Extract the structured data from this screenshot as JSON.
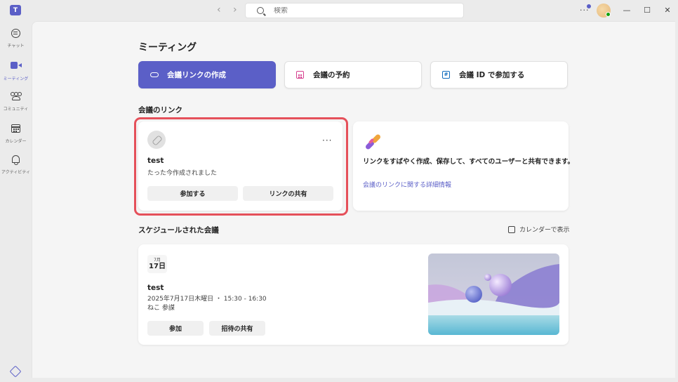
{
  "titlebar": {
    "search_placeholder": "検索",
    "more": "···",
    "window_controls": {
      "minimize": "—",
      "maximize": "☐",
      "close": "✕"
    }
  },
  "rail": {
    "items": [
      {
        "label": "チャット",
        "icon": "chat-icon"
      },
      {
        "label": "ミーティング",
        "icon": "meeting-icon",
        "active": true
      },
      {
        "label": "コミュニティ",
        "icon": "community-icon"
      },
      {
        "label": "カレンダー",
        "icon": "calendar-icon"
      },
      {
        "label": "アクティビティ",
        "icon": "bell-icon"
      }
    ]
  },
  "page": {
    "title": "ミーティング",
    "actions": {
      "create_link": "会議リンクの作成",
      "schedule": "会議の予約",
      "join_id": "会議 ID で参加する"
    }
  },
  "links_section": {
    "title": "会議のリンク",
    "card": {
      "name": "test",
      "status": "たった今作成されました",
      "join": "参加する",
      "share": "リンクの共有",
      "more": "···"
    },
    "promo": {
      "text": "リンクをすばやく作成、保存して、すべてのユーザーと共有できます。",
      "link": "会議のリンクに関する詳細情報"
    }
  },
  "scheduled_section": {
    "title": "スケジュールされた会議",
    "calendar_view": "カレンダーで表示",
    "meeting": {
      "month": "7月",
      "day": "17日",
      "name": "test",
      "datetime": "2025年7月17日木曜日 ・ 15:30 - 16:30",
      "organizer": "ねこ 参謀",
      "join": "参加",
      "share_invite": "招待の共有"
    }
  },
  "colors": {
    "accent": "#5b5fc7",
    "highlight": "#e5505a",
    "presence": "#13a10e"
  }
}
